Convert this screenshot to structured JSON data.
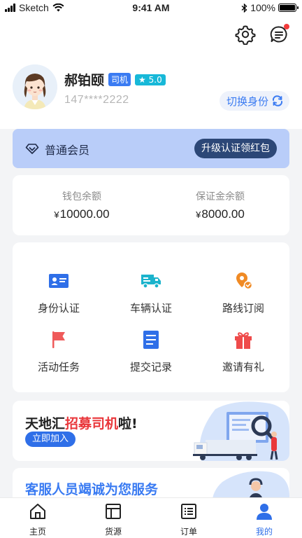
{
  "status_bar": {
    "carrier": "Sketch",
    "time": "9:41 AM",
    "battery": "100%",
    "battery_level": 1.0
  },
  "header": {
    "settings_icon": "gear-icon",
    "messages_icon": "chat-icon"
  },
  "profile": {
    "name": "郝铂颐",
    "role_badge": "司机",
    "rating": "5.0",
    "phone": "147****2222",
    "switch_label": "切换身份"
  },
  "membership": {
    "level": "普通会员",
    "upgrade_label": "升级认证领红包"
  },
  "wallet": {
    "balance_label": "钱包余额",
    "balance_currency": "¥",
    "balance_value": "10000.00",
    "deposit_label": "保证金余额",
    "deposit_currency": "¥",
    "deposit_value": "8000.00"
  },
  "services": [
    {
      "label": "身份认证",
      "icon": "id-card-icon",
      "color": "#2f6fe8"
    },
    {
      "label": "车辆认证",
      "icon": "truck-icon",
      "color": "#1bb3cc"
    },
    {
      "label": "路线订阅",
      "icon": "route-pin-icon",
      "color": "#f08a24"
    },
    {
      "label": "活动任务",
      "icon": "flag-icon",
      "color": "#ef5a5a"
    },
    {
      "label": "提交记录",
      "icon": "document-icon",
      "color": "#2f6fe8"
    },
    {
      "label": "邀请有礼",
      "icon": "gift-icon",
      "color": "#ef4b4b"
    }
  ],
  "recruit_banner": {
    "prefix": "天地汇",
    "highlight": "招募司机",
    "suffix": "啦!",
    "button": "立即加入"
  },
  "service_banner": {
    "title": "客服人员竭诚为您服务"
  },
  "tabbar": [
    {
      "label": "主页",
      "icon": "home-icon",
      "active": false
    },
    {
      "label": "货源",
      "icon": "cargo-icon",
      "active": false
    },
    {
      "label": "订单",
      "icon": "order-list-icon",
      "active": false
    },
    {
      "label": "我的",
      "icon": "user-icon",
      "active": true
    }
  ]
}
